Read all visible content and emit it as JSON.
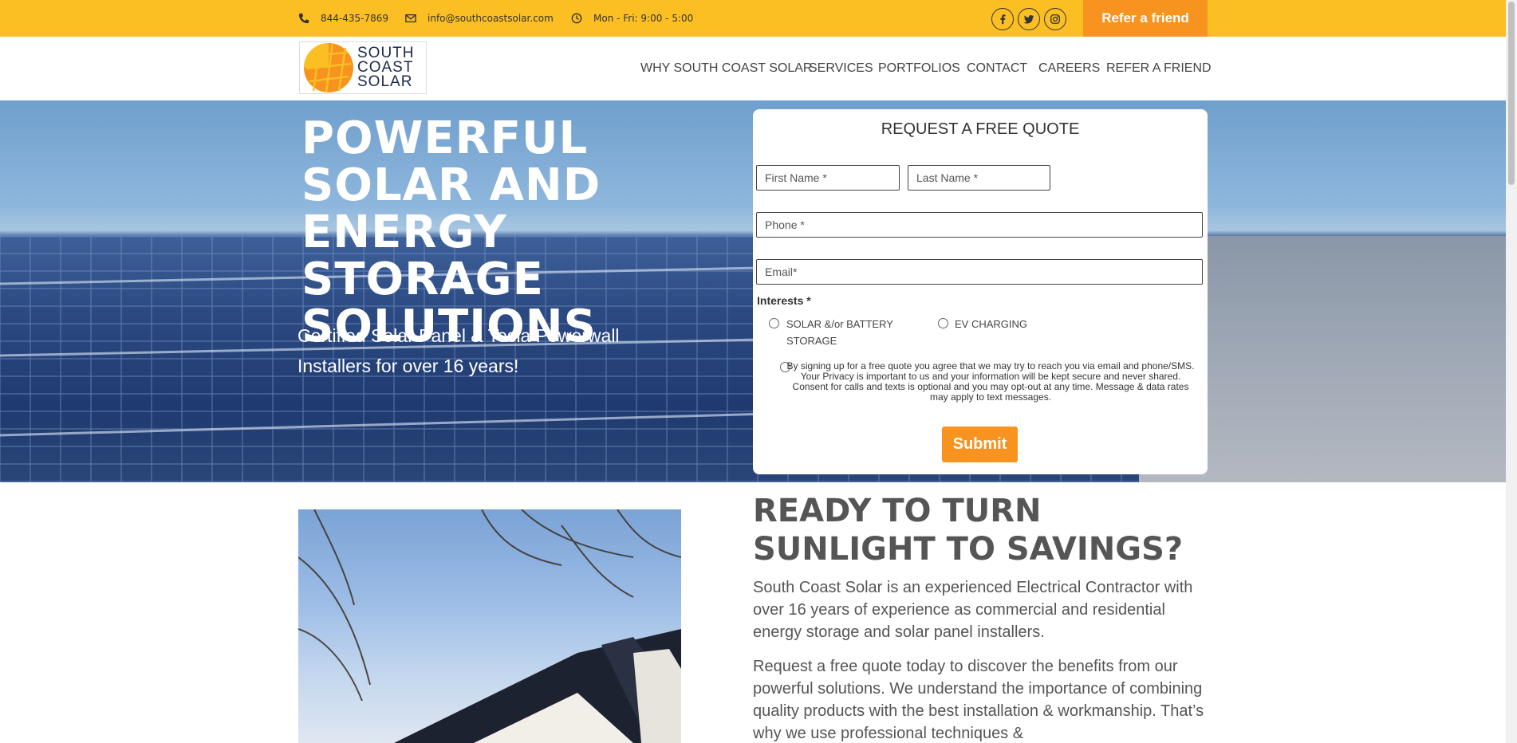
{
  "topbar": {
    "phone": "844-435-7869",
    "email": "info@southcoastsolar.com",
    "hours": "Mon - Fri: 9:00 - 5:00",
    "refer_label": "Refer a friend",
    "bg_color": "#fbbf24",
    "accent_color": "#f7931e",
    "icons": [
      "phone-icon",
      "envelope-icon",
      "clock-icon",
      "facebook-icon",
      "twitter-icon",
      "instagram-icon"
    ]
  },
  "logo": {
    "line1": "SOUTH",
    "line2": "COAST",
    "line3": "SOLAR"
  },
  "nav": {
    "items": [
      "WHY SOUTH COAST SOLAR",
      "SERVICES",
      "PORTFOLIOS",
      "CONTACT",
      "CAREERS",
      "REFER A FRIEND"
    ]
  },
  "hero": {
    "title": "POWERFUL SOLAR AND ENERGY STORAGE SOLUTIONS",
    "subtitle": "Certified Solar Panel & Tesla Powerwall Installers for over 16 years!"
  },
  "quote_form": {
    "title": "REQUEST A FREE QUOTE",
    "first_name_placeholder": "First Name *",
    "last_name_placeholder": "Last Name *",
    "phone_placeholder": "Phone *",
    "email_placeholder": "Email*",
    "interests_label": "Interests *",
    "option_solar": "SOLAR &/or BATTERY STORAGE",
    "option_ev": "EV CHARGING",
    "consent": "By signing up for a free quote you agree that we may try to reach you via email and phone/SMS. Your Privacy is important to us and your information will be kept secure and never shared. Consent for calls and texts is optional and you may opt-out at any time. Message & data rates may apply to text messages.",
    "submit_label": "Submit"
  },
  "section": {
    "heading": "READY TO TURN SUNLIGHT TO SAVINGS?",
    "para1": "South Coast Solar is an experienced Electrical Contractor with over 16 years of experience as commercial and residential energy storage and solar panel installers.",
    "para2": "Request a free quote today to discover the benefits from our powerful solutions. We understand the importance of combining quality products with the best installation & workmanship. That’s why we use professional techniques &"
  }
}
